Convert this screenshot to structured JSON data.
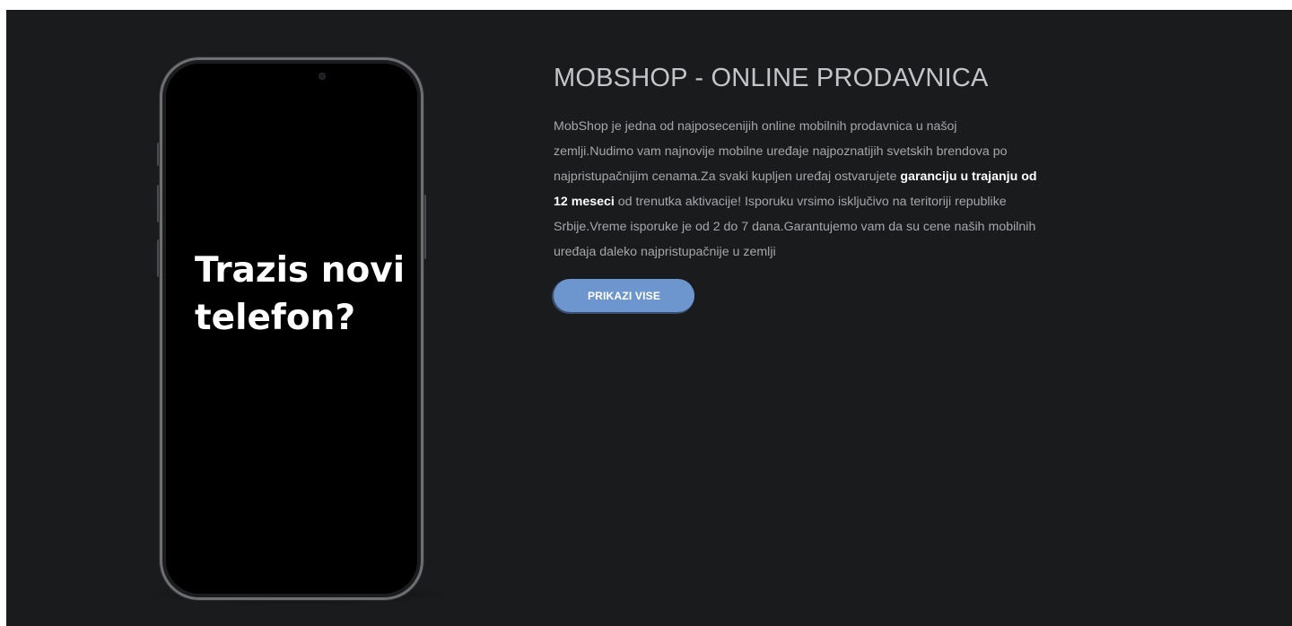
{
  "phone": {
    "screen_text_line1": "Trazis novi",
    "screen_text_line2": "telefon?"
  },
  "about": {
    "title": "MOBSHOP - ONLINE PRODAVNICA",
    "text_part1": "MobShop je jedna od najposecenijih online mobilnih prodavnica u našoj zemlji.Nudimo vam najnovije mobilne uređaje najpoznatijih svetskih brendova po najpristupačnijim cenama.Za svaki kupljen uređaj ostvarujete ",
    "text_bold": "garanciju u trajanju od 12 meseci",
    "text_part2": " od trenutka aktivacije! Isporuku vrsimo isključivo na teritoriji republike Srbije.Vreme isporuke je od 2 do 7 dana.Garantujemo vam da su cene naših mobilnih uređaja daleko najpristupačnije u zemlji",
    "button_label": "PRIKAZI VISE"
  },
  "colors": {
    "background": "#1a1b1d",
    "title": "#c4c5c9",
    "text": "#a6a7ab",
    "button": "#6d96cf"
  }
}
